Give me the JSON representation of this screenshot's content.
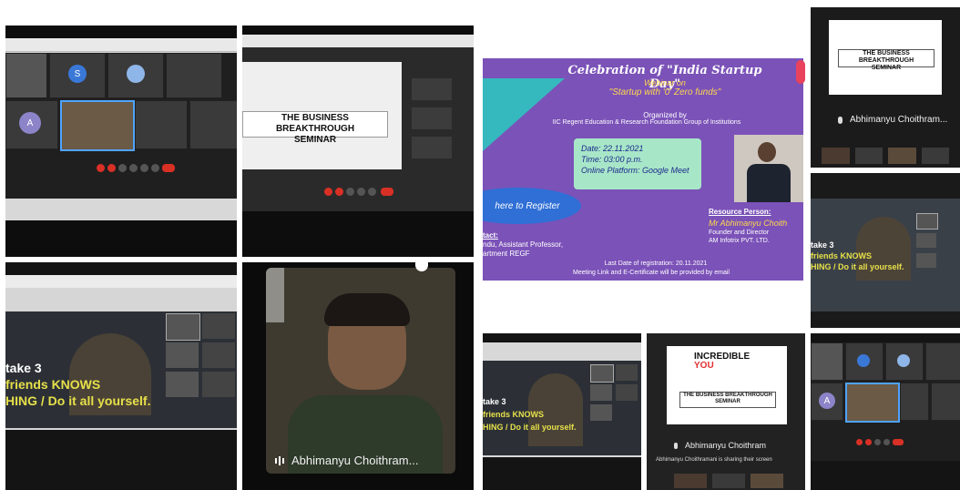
{
  "collage": {
    "tile_presentation_1": {
      "title": "THE BUSINESS BREAKTHROUGH",
      "subtitle": "SEMINAR"
    },
    "tile_video_main": {
      "caption": "Abhimanyu Choithram..."
    },
    "tile_top_right": {
      "title": "THE BUSINESS BREAKTHROUGH",
      "subtitle": "SEMINAR",
      "caption": "Abhimanyu Choithram..."
    },
    "slide_text": {
      "line1": "take 3",
      "line2": "friends KNOWS",
      "line3": "HING / Do it all yourself."
    },
    "tile_incredible": {
      "line1": "INCREDIBLE",
      "line2": "YOU",
      "box_title": "THE BUSINESS BREAKTHROUGH",
      "box_subtitle": "SEMINAR",
      "caption": "Abhimanyu Choithram",
      "share_note": "Abhimanyu Choithramani is sharing their screen"
    },
    "participant_initials": [
      "S",
      "A",
      "A"
    ]
  },
  "poster": {
    "heading": "Celebration of \"India Startup Day\"",
    "webinar_line": "Webinar on",
    "topic": "\"Startup with '0' Zero funds\"",
    "organized_by": "Organized by",
    "org_name": "IIC Regent Education & Research Foundation Group of Institutions",
    "date": "Date: 22.11.2021",
    "time": "Time: 03:00 p.m.",
    "platform": "Online Platform: Google Meet",
    "register": "here to Register",
    "contact_label": "tact:",
    "contact_line1": "ndu, Assistant Professor,",
    "contact_line2": "artment REGF",
    "resource_label": "Resource Person:",
    "resource_name": "Mr Abhimanyu Choith",
    "resource_role": "Founder and Director",
    "resource_company": "AM Infotrix PVT. LTD.",
    "last_date": "Last Date of registration: 20.11.2021",
    "meeting_note": "Meeting Link and E-Certificate will be provided by email",
    "colors": {
      "background": "#7b52b8",
      "accent_teal": "#2ec4c0",
      "accent_blue": "#2f6fd6",
      "note_green": "#a8e6c8"
    }
  }
}
